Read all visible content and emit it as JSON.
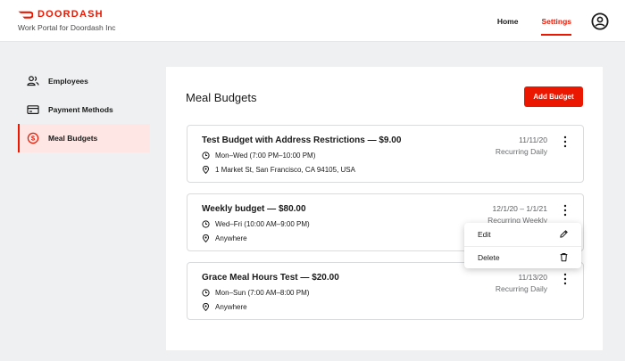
{
  "header": {
    "brand": "DOORDASH",
    "subtitle": "Work Portal for Doordash Inc",
    "nav": {
      "home": "Home",
      "settings": "Settings"
    },
    "active_nav": "Settings",
    "accent_color": "#eb1700"
  },
  "sidebar": {
    "items": [
      {
        "label": "Employees",
        "icon": "users-icon",
        "active": false
      },
      {
        "label": "Payment Methods",
        "icon": "credit-card-icon",
        "active": false
      },
      {
        "label": "Meal Budgets",
        "icon": "dollar-circle-icon",
        "active": true
      }
    ]
  },
  "main": {
    "title": "Meal Budgets",
    "add_button": "Add Budget",
    "budgets": [
      {
        "title": "Test Budget with Address Restrictions — $9.00",
        "hours": "Mon–Wed (7:00 PM–10:00 PM)",
        "location": "1 Market St, San Francisco, CA 94105, USA",
        "date": "11/11/20",
        "recurrence": "Recurring Daily"
      },
      {
        "title": "Weekly budget — $80.00",
        "hours": "Wed–Fri (10:00 AM–9:00 PM)",
        "location": "Anywhere",
        "date": "12/1/20 – 1/1/21",
        "recurrence": "Recurring Weekly"
      },
      {
        "title": "Grace Meal Hours Test — $20.00",
        "hours": "Mon–Sun (7:00 AM–8:00 PM)",
        "location": "Anywhere",
        "date": "11/13/20",
        "recurrence": "Recurring Daily"
      }
    ]
  },
  "context_menu": {
    "items": [
      {
        "label": "Edit",
        "icon": "pencil-icon"
      },
      {
        "label": "Delete",
        "icon": "trash-icon"
      }
    ]
  }
}
